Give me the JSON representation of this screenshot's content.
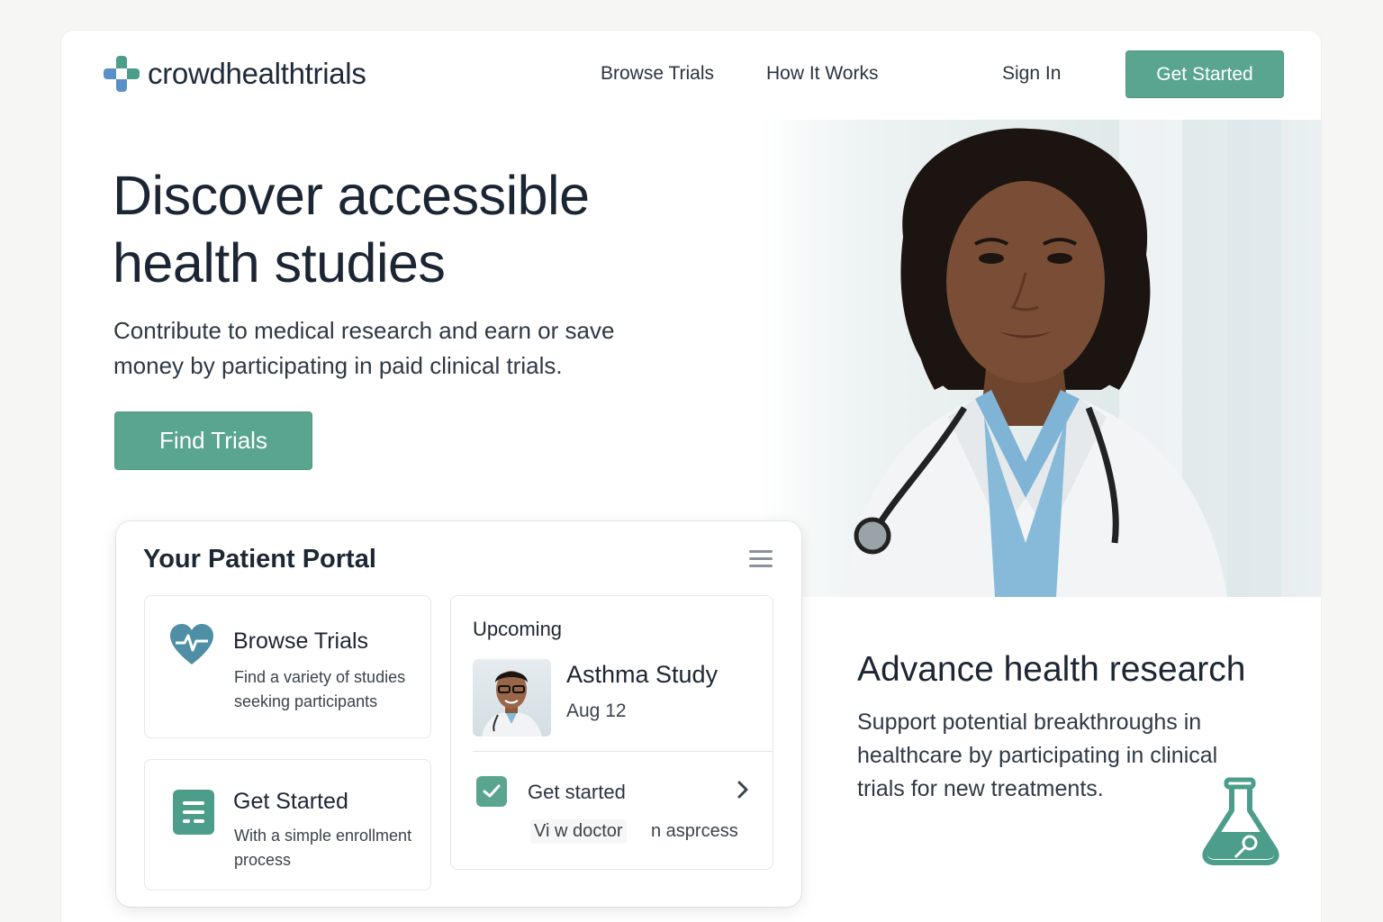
{
  "brand": {
    "name": "crowdhealthtrials",
    "accent": "#5aa58f",
    "logo_colors": [
      "#4c9d8a",
      "#5b8fc7"
    ]
  },
  "nav": {
    "browse_trials": "Browse Trials",
    "how_it_works": "How It Works",
    "sign_in": "Sign In",
    "get_started": "Get Started"
  },
  "hero": {
    "title": "Discover accessible health studies",
    "subtitle": "Contribute to medical research and earn or save money by participating in paid clinical trials.",
    "cta": "Find Trials",
    "photo_icon": "doctor-portrait"
  },
  "portal": {
    "title": "Your Patient Portal",
    "menu_icon": "hamburger-menu-icon",
    "browse": {
      "icon": "heart-pulse-icon",
      "title": "Browse Trials",
      "description": "Find a variety of studies seeking participants"
    },
    "get_started": {
      "icon": "document-icon",
      "title": "Get Started",
      "description": "With a simple enrollment process"
    },
    "upcoming": {
      "label": "Upcoming",
      "study_name": "Asthma Study",
      "date": "Aug 12",
      "avatar_icon": "doctor-avatar",
      "task_label": "Get started",
      "task_icon": "check-icon",
      "link_doctor": "Vi w doctor",
      "link_process": "n asprcess"
    }
  },
  "advance": {
    "title": "Advance health research",
    "description": "Support potential breakthroughs in healthcare by participating in clinical trials for new treatments.",
    "icon": "flask-icon"
  }
}
